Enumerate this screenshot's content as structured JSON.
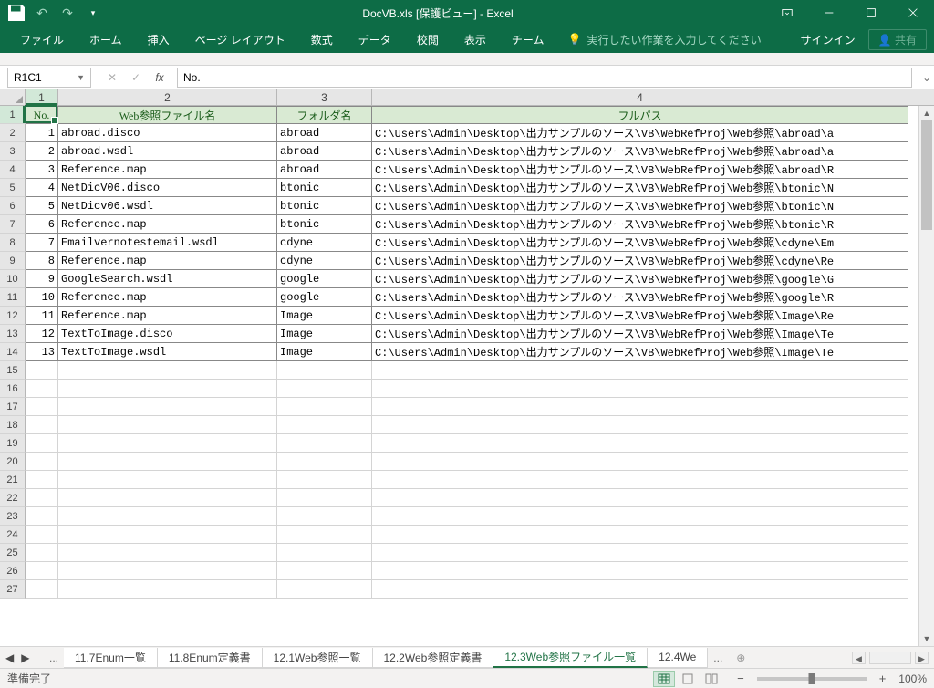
{
  "title": "DocVB.xls  [保護ビュー] - Excel",
  "titlebar": {
    "ribbon_display_icon": "▾"
  },
  "win": {
    "signin": "サインイン",
    "share": "共有"
  },
  "ribbon": {
    "tabs": [
      "ファイル",
      "ホーム",
      "挿入",
      "ページ レイアウト",
      "数式",
      "データ",
      "校閲",
      "表示",
      "チーム"
    ],
    "tellme": "実行したい作業を入力してください"
  },
  "fx": {
    "namebox": "R1C1",
    "value": "No."
  },
  "columns": [
    "1",
    "2",
    "3",
    "4"
  ],
  "headers": {
    "no": "No.",
    "file": "Web参照ファイル名",
    "folder": "フォルダ名",
    "path": "フルパス"
  },
  "rows": [
    {
      "no": "1",
      "file": "abroad.disco",
      "folder": "abroad",
      "path": "C:\\Users\\Admin\\Desktop\\出力サンプルのソース\\VB\\WebRefProj\\Web参照\\abroad\\a"
    },
    {
      "no": "2",
      "file": "abroad.wsdl",
      "folder": "abroad",
      "path": "C:\\Users\\Admin\\Desktop\\出力サンプルのソース\\VB\\WebRefProj\\Web参照\\abroad\\a"
    },
    {
      "no": "3",
      "file": "Reference.map",
      "folder": "abroad",
      "path": "C:\\Users\\Admin\\Desktop\\出力サンプルのソース\\VB\\WebRefProj\\Web参照\\abroad\\R"
    },
    {
      "no": "4",
      "file": "NetDicV06.disco",
      "folder": "btonic",
      "path": "C:\\Users\\Admin\\Desktop\\出力サンプルのソース\\VB\\WebRefProj\\Web参照\\btonic\\N"
    },
    {
      "no": "5",
      "file": "NetDicv06.wsdl",
      "folder": "btonic",
      "path": "C:\\Users\\Admin\\Desktop\\出力サンプルのソース\\VB\\WebRefProj\\Web参照\\btonic\\N"
    },
    {
      "no": "6",
      "file": "Reference.map",
      "folder": "btonic",
      "path": "C:\\Users\\Admin\\Desktop\\出力サンプルのソース\\VB\\WebRefProj\\Web参照\\btonic\\R"
    },
    {
      "no": "7",
      "file": "Emailvernotestemail.wsdl",
      "folder": "cdyne",
      "path": "C:\\Users\\Admin\\Desktop\\出力サンプルのソース\\VB\\WebRefProj\\Web参照\\cdyne\\Em"
    },
    {
      "no": "8",
      "file": "Reference.map",
      "folder": "cdyne",
      "path": "C:\\Users\\Admin\\Desktop\\出力サンプルのソース\\VB\\WebRefProj\\Web参照\\cdyne\\Re"
    },
    {
      "no": "9",
      "file": "GoogleSearch.wsdl",
      "folder": "google",
      "path": "C:\\Users\\Admin\\Desktop\\出力サンプルのソース\\VB\\WebRefProj\\Web参照\\google\\G"
    },
    {
      "no": "10",
      "file": "Reference.map",
      "folder": "google",
      "path": "C:\\Users\\Admin\\Desktop\\出力サンプルのソース\\VB\\WebRefProj\\Web参照\\google\\R"
    },
    {
      "no": "11",
      "file": "Reference.map",
      "folder": "Image",
      "path": "C:\\Users\\Admin\\Desktop\\出力サンプルのソース\\VB\\WebRefProj\\Web参照\\Image\\Re"
    },
    {
      "no": "12",
      "file": "TextToImage.disco",
      "folder": "Image",
      "path": "C:\\Users\\Admin\\Desktop\\出力サンプルのソース\\VB\\WebRefProj\\Web参照\\Image\\Te"
    },
    {
      "no": "13",
      "file": "TextToImage.wsdl",
      "folder": "Image",
      "path": "C:\\Users\\Admin\\Desktop\\出力サンプルのソース\\VB\\WebRefProj\\Web参照\\Image\\Te"
    }
  ],
  "empty_row_start": 15,
  "empty_row_end": 27,
  "sheets": {
    "tabs": [
      "11.7Enum一覧",
      "11.8Enum定義書",
      "12.1Web参照一覧",
      "12.2Web参照定義書",
      "12.3Web参照ファイル一覧",
      "12.4We"
    ],
    "active_index": 4,
    "ellipsis_left": "...",
    "ellipsis_right": "...",
    "add": "⊕"
  },
  "status": {
    "ready": "準備完了",
    "zoom": "100%",
    "minus": "−",
    "plus": "+"
  }
}
